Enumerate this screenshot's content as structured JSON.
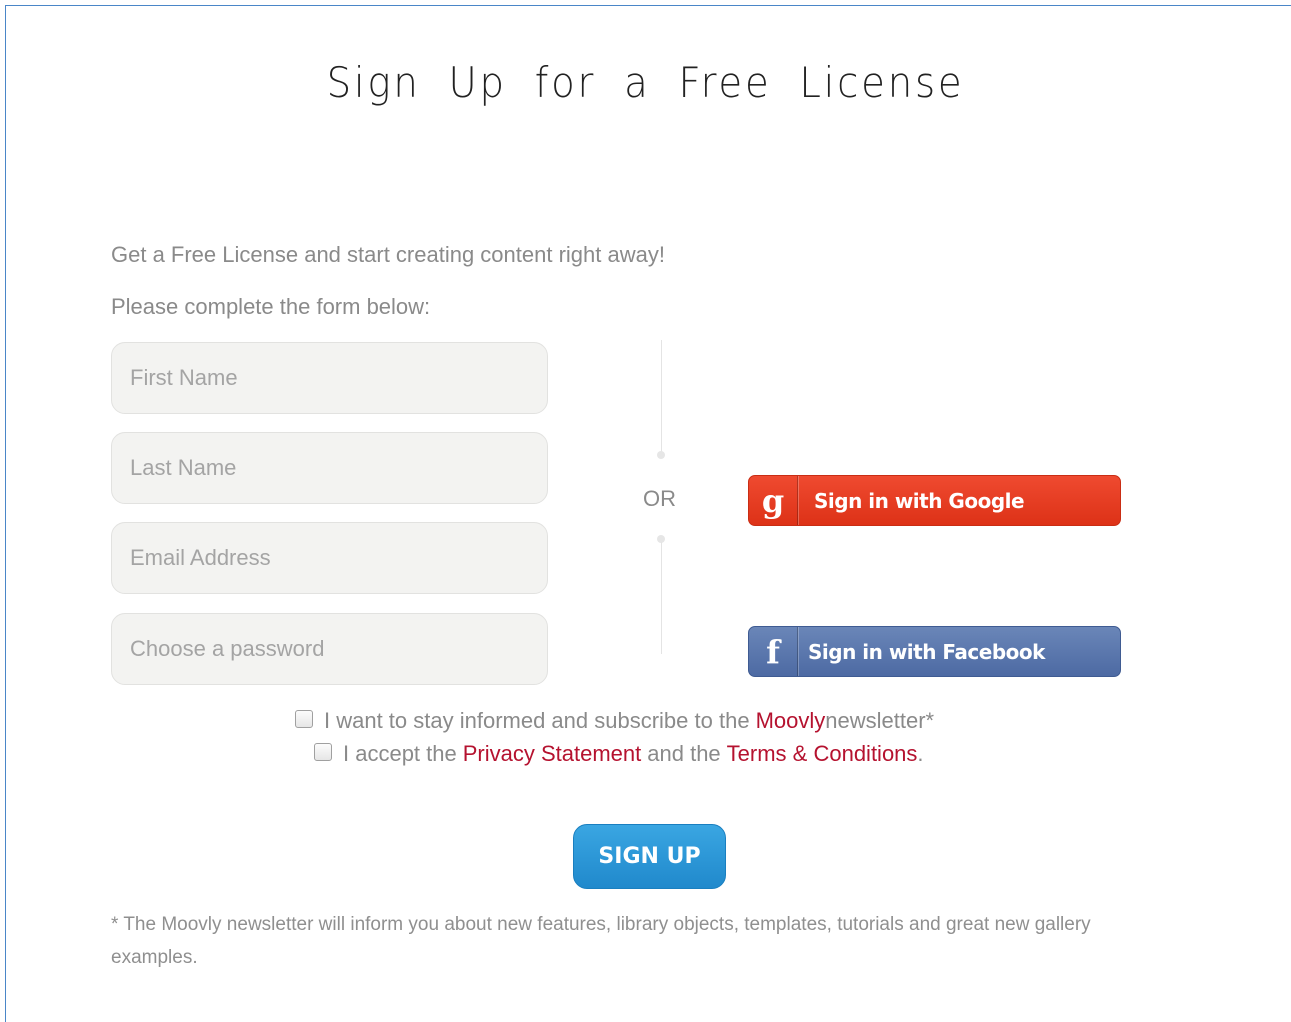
{
  "page": {
    "title": "Sign Up for a Free License"
  },
  "intro": {
    "line1": "Get a Free License and start creating content right away!",
    "line2": "Please complete the form below:"
  },
  "form": {
    "first_name_placeholder": "First Name",
    "last_name_placeholder": "Last Name",
    "email_placeholder": "Email Address",
    "password_placeholder": "Choose a password"
  },
  "divider": {
    "or_label": "OR"
  },
  "social": {
    "google": {
      "icon_glyph": "g",
      "icon_name": "google-icon",
      "label": "Sign in with Google",
      "color": "#e63e23"
    },
    "facebook": {
      "icon_glyph": "f",
      "icon_name": "facebook-icon",
      "label": "Sign in with Facebook",
      "color": "#5a77ad"
    }
  },
  "consent": {
    "newsletter": {
      "prefix": "I want to stay informed and subscribe to the ",
      "brand": "Moovly",
      "suffix": " newsletter*",
      "checked": false
    },
    "terms": {
      "prefix": "I accept the ",
      "privacy_link": "Privacy Statement",
      "middle": " and the ",
      "terms_link": "Terms & Conditions",
      "suffix": ".",
      "checked": false
    }
  },
  "actions": {
    "signup_label": "SIGN UP",
    "signup_color": "#2b97d8"
  },
  "footnote": {
    "text": "* The Moovly newsletter will inform you about new features, library objects, templates, tutorials and great new gallery examples."
  },
  "colors": {
    "accent_red": "#b5122f",
    "frame_border": "#4a86c8"
  }
}
